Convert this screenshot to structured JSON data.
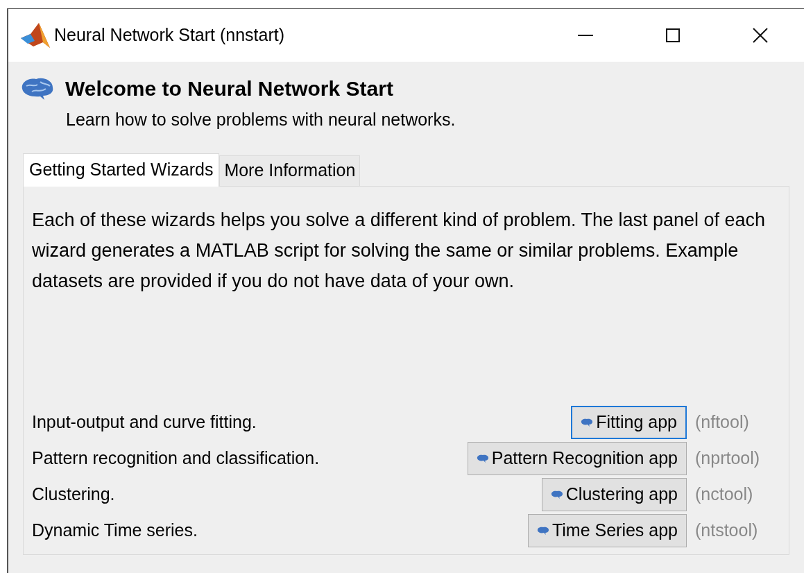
{
  "window": {
    "title": "Neural Network Start (nnstart)"
  },
  "header": {
    "title": "Welcome to Neural Network Start",
    "subtitle": "Learn how to solve problems with neural networks."
  },
  "tabs": [
    {
      "label": "Getting Started Wizards",
      "selected": true
    },
    {
      "label": "More Information",
      "selected": false
    }
  ],
  "description": "Each of these wizards helps you solve a different kind of problem. The last panel of each wizard generates a MATLAB script for solving the same or similar problems. Example datasets are provided if you do not have data of your own.",
  "wizards": [
    {
      "label": "Input-output and curve fitting.",
      "button": "Fitting app",
      "tool": "(nftool)",
      "focused": true
    },
    {
      "label": "Pattern recognition and classification.",
      "button": "Pattern Recognition app",
      "tool": "(nprtool)",
      "focused": false
    },
    {
      "label": "Clustering.",
      "button": "Clustering app",
      "tool": "(nctool)",
      "focused": false
    },
    {
      "label": "Dynamic Time series.",
      "button": "Time Series app",
      "tool": "(ntstool)",
      "focused": false
    }
  ]
}
